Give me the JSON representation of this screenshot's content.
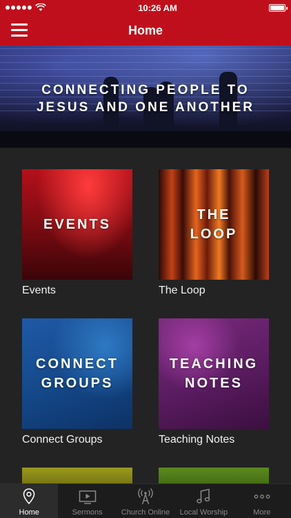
{
  "statusbar": {
    "time": "10:26 AM"
  },
  "nav": {
    "title": "Home"
  },
  "hero": {
    "line1": "CONNECTING PEOPLE TO",
    "line2": "JESUS AND ONE ANOTHER"
  },
  "tiles": [
    {
      "title_lines": [
        "EVENTS"
      ],
      "caption": "Events"
    },
    {
      "title_lines": [
        "THE",
        "LOOP"
      ],
      "caption": "The Loop"
    },
    {
      "title_lines": [
        "CONNECT",
        "GROUPS"
      ],
      "caption": "Connect Groups"
    },
    {
      "title_lines": [
        "TEACHING",
        "NOTES"
      ],
      "caption": "Teaching Notes"
    }
  ],
  "tabs": [
    {
      "label": "Home",
      "icon": "map-pin-icon",
      "active": true
    },
    {
      "label": "Sermons",
      "icon": "tv-icon",
      "active": false
    },
    {
      "label": "Church Online",
      "icon": "broadcast-tower-icon",
      "active": false
    },
    {
      "label": "Local Worship",
      "icon": "music-note-icon",
      "active": false
    },
    {
      "label": "More",
      "icon": "more-dots-icon",
      "active": false
    }
  ],
  "colors": {
    "brand_red": "#c00f1c",
    "background": "#232323",
    "tabbar": "#1c1c1c"
  }
}
